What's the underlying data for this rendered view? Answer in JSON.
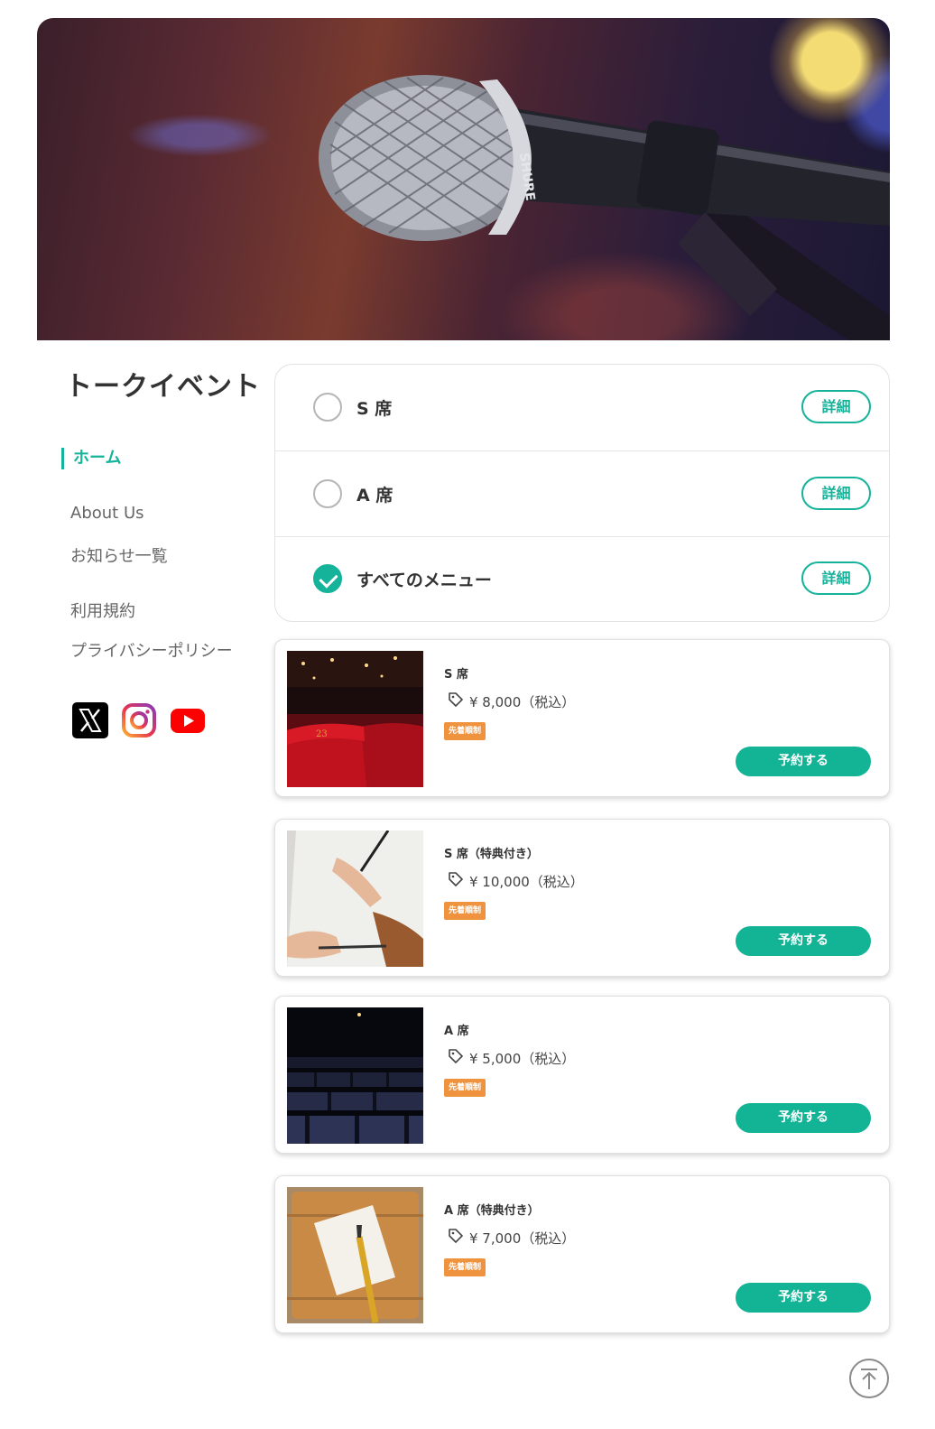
{
  "site": {
    "title": "トークイベント"
  },
  "hero": {
    "image": "microphone-photo",
    "brand_text": "SHURE"
  },
  "nav": {
    "home": "ホーム",
    "about": "About Us",
    "news": "お知らせ一覧",
    "terms": "利用規約",
    "privacy": "プライバシーポリシー"
  },
  "social": [
    "x-icon",
    "instagram-icon",
    "youtube-icon"
  ],
  "menu": {
    "detail_label": "詳細",
    "items": [
      {
        "label": "S 席",
        "selected": false
      },
      {
        "label": "A 席",
        "selected": false
      },
      {
        "label": "すべてのメニュー",
        "selected": true
      }
    ]
  },
  "products": [
    {
      "title": "S 席",
      "price": "¥ 8,000（税込）",
      "badge": "先着順制",
      "button": "予約する",
      "image": "red-theater-seats-photo"
    },
    {
      "title": "S 席（特典付き）",
      "price": "¥ 10,000（税込）",
      "badge": "先着順制",
      "button": "予約する",
      "image": "writing-hand-notebook-photo"
    },
    {
      "title": "A 席",
      "price": "¥ 5,000（税込）",
      "badge": "先着順制",
      "button": "予約する",
      "image": "dark-theater-seats-photo"
    },
    {
      "title": "A 席（特典付き）",
      "price": "¥ 7,000（税込）",
      "badge": "先着順制",
      "button": "予約する",
      "image": "notebook-fountain-pen-photo"
    }
  ],
  "colors": {
    "accent": "#14b39a",
    "badge": "#f0933e"
  }
}
